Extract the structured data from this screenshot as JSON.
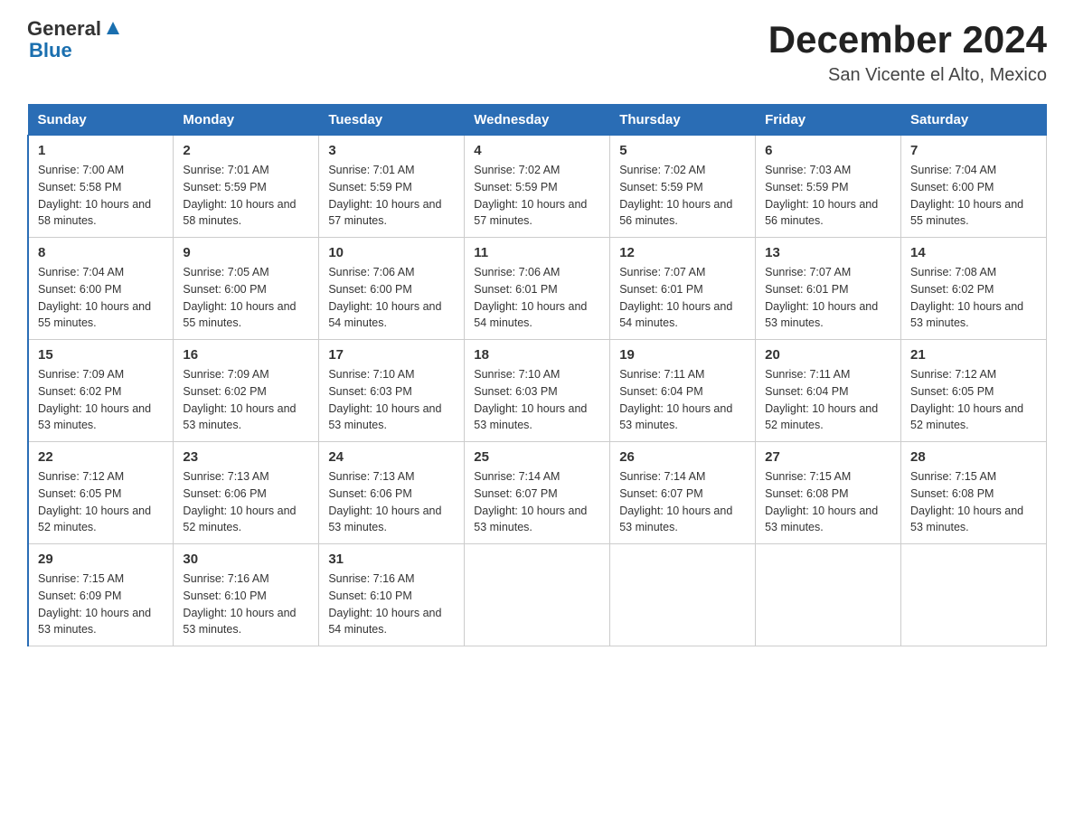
{
  "logo": {
    "text_general": "General",
    "text_blue": "Blue",
    "aria": "GeneralBlue logo"
  },
  "title": "December 2024",
  "subtitle": "San Vicente el Alto, Mexico",
  "days_of_week": [
    "Sunday",
    "Monday",
    "Tuesday",
    "Wednesday",
    "Thursday",
    "Friday",
    "Saturday"
  ],
  "weeks": [
    [
      {
        "day": "1",
        "sunrise": "7:00 AM",
        "sunset": "5:58 PM",
        "daylight": "10 hours and 58 minutes."
      },
      {
        "day": "2",
        "sunrise": "7:01 AM",
        "sunset": "5:59 PM",
        "daylight": "10 hours and 58 minutes."
      },
      {
        "day": "3",
        "sunrise": "7:01 AM",
        "sunset": "5:59 PM",
        "daylight": "10 hours and 57 minutes."
      },
      {
        "day": "4",
        "sunrise": "7:02 AM",
        "sunset": "5:59 PM",
        "daylight": "10 hours and 57 minutes."
      },
      {
        "day": "5",
        "sunrise": "7:02 AM",
        "sunset": "5:59 PM",
        "daylight": "10 hours and 56 minutes."
      },
      {
        "day": "6",
        "sunrise": "7:03 AM",
        "sunset": "5:59 PM",
        "daylight": "10 hours and 56 minutes."
      },
      {
        "day": "7",
        "sunrise": "7:04 AM",
        "sunset": "6:00 PM",
        "daylight": "10 hours and 55 minutes."
      }
    ],
    [
      {
        "day": "8",
        "sunrise": "7:04 AM",
        "sunset": "6:00 PM",
        "daylight": "10 hours and 55 minutes."
      },
      {
        "day": "9",
        "sunrise": "7:05 AM",
        "sunset": "6:00 PM",
        "daylight": "10 hours and 55 minutes."
      },
      {
        "day": "10",
        "sunrise": "7:06 AM",
        "sunset": "6:00 PM",
        "daylight": "10 hours and 54 minutes."
      },
      {
        "day": "11",
        "sunrise": "7:06 AM",
        "sunset": "6:01 PM",
        "daylight": "10 hours and 54 minutes."
      },
      {
        "day": "12",
        "sunrise": "7:07 AM",
        "sunset": "6:01 PM",
        "daylight": "10 hours and 54 minutes."
      },
      {
        "day": "13",
        "sunrise": "7:07 AM",
        "sunset": "6:01 PM",
        "daylight": "10 hours and 53 minutes."
      },
      {
        "day": "14",
        "sunrise": "7:08 AM",
        "sunset": "6:02 PM",
        "daylight": "10 hours and 53 minutes."
      }
    ],
    [
      {
        "day": "15",
        "sunrise": "7:09 AM",
        "sunset": "6:02 PM",
        "daylight": "10 hours and 53 minutes."
      },
      {
        "day": "16",
        "sunrise": "7:09 AM",
        "sunset": "6:02 PM",
        "daylight": "10 hours and 53 minutes."
      },
      {
        "day": "17",
        "sunrise": "7:10 AM",
        "sunset": "6:03 PM",
        "daylight": "10 hours and 53 minutes."
      },
      {
        "day": "18",
        "sunrise": "7:10 AM",
        "sunset": "6:03 PM",
        "daylight": "10 hours and 53 minutes."
      },
      {
        "day": "19",
        "sunrise": "7:11 AM",
        "sunset": "6:04 PM",
        "daylight": "10 hours and 53 minutes."
      },
      {
        "day": "20",
        "sunrise": "7:11 AM",
        "sunset": "6:04 PM",
        "daylight": "10 hours and 52 minutes."
      },
      {
        "day": "21",
        "sunrise": "7:12 AM",
        "sunset": "6:05 PM",
        "daylight": "10 hours and 52 minutes."
      }
    ],
    [
      {
        "day": "22",
        "sunrise": "7:12 AM",
        "sunset": "6:05 PM",
        "daylight": "10 hours and 52 minutes."
      },
      {
        "day": "23",
        "sunrise": "7:13 AM",
        "sunset": "6:06 PM",
        "daylight": "10 hours and 52 minutes."
      },
      {
        "day": "24",
        "sunrise": "7:13 AM",
        "sunset": "6:06 PM",
        "daylight": "10 hours and 53 minutes."
      },
      {
        "day": "25",
        "sunrise": "7:14 AM",
        "sunset": "6:07 PM",
        "daylight": "10 hours and 53 minutes."
      },
      {
        "day": "26",
        "sunrise": "7:14 AM",
        "sunset": "6:07 PM",
        "daylight": "10 hours and 53 minutes."
      },
      {
        "day": "27",
        "sunrise": "7:15 AM",
        "sunset": "6:08 PM",
        "daylight": "10 hours and 53 minutes."
      },
      {
        "day": "28",
        "sunrise": "7:15 AM",
        "sunset": "6:08 PM",
        "daylight": "10 hours and 53 minutes."
      }
    ],
    [
      {
        "day": "29",
        "sunrise": "7:15 AM",
        "sunset": "6:09 PM",
        "daylight": "10 hours and 53 minutes."
      },
      {
        "day": "30",
        "sunrise": "7:16 AM",
        "sunset": "6:10 PM",
        "daylight": "10 hours and 53 minutes."
      },
      {
        "day": "31",
        "sunrise": "7:16 AM",
        "sunset": "6:10 PM",
        "daylight": "10 hours and 54 minutes."
      },
      null,
      null,
      null,
      null
    ]
  ]
}
